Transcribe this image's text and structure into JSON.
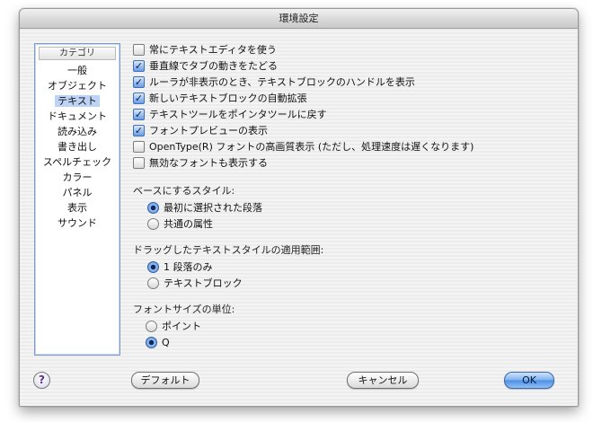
{
  "window": {
    "title": "環境設定"
  },
  "sidebar": {
    "header": "カテゴリ",
    "items": [
      "一般",
      "オブジェクト",
      "テキスト",
      "ドキュメント",
      "読み込み",
      "書き出し",
      "スペルチェック",
      "カラー",
      "パネル",
      "表示",
      "サウンド"
    ],
    "selected": "テキスト"
  },
  "options": [
    {
      "label": "常にテキストエディタを使う",
      "checked": false
    },
    {
      "label": "垂直線でタブの動きをたどる",
      "checked": true
    },
    {
      "label": "ルーラが非表示のとき、テキストブロックのハンドルを表示",
      "checked": true
    },
    {
      "label": "新しいテキストブロックの自動拡張",
      "checked": true
    },
    {
      "label": "テキストツールをポインタツールに戻す",
      "checked": true
    },
    {
      "label": "フォントプレビューの表示",
      "checked": true
    },
    {
      "label": "OpenType(R) フォントの高画質表示 (ただし、処理速度は遅くなります)",
      "checked": false
    },
    {
      "label": "無効なフォントも表示する",
      "checked": false
    }
  ],
  "base_style": {
    "label": "ベースにするスタイル:",
    "options": [
      {
        "label": "最初に選択された段落",
        "selected": true
      },
      {
        "label": "共通の属性",
        "selected": false
      }
    ]
  },
  "drag_scope": {
    "label": "ドラッグしたテキストスタイルの適用範囲:",
    "options": [
      {
        "label": "1 段落のみ",
        "selected": true
      },
      {
        "label": "テキストブロック",
        "selected": false
      }
    ]
  },
  "font_unit": {
    "label": "フォントサイズの単位:",
    "options": [
      {
        "label": "ポイント",
        "selected": false
      },
      {
        "label": "Q",
        "selected": true
      }
    ]
  },
  "footer": {
    "help": "?",
    "default": "デフォルト",
    "cancel": "キャンセル",
    "ok": "OK"
  }
}
